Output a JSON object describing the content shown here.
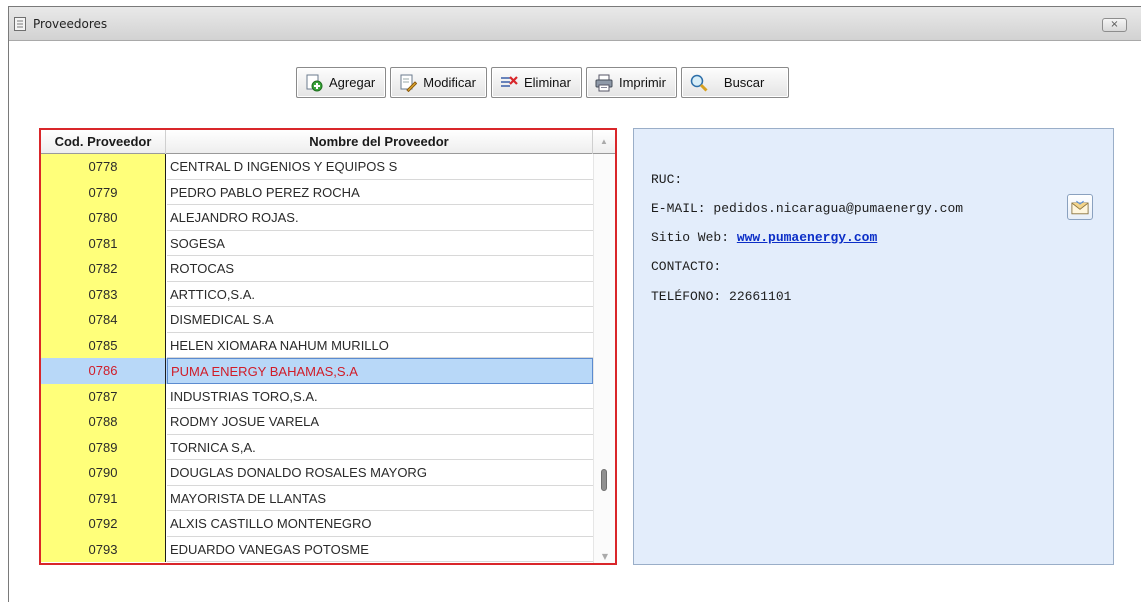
{
  "window": {
    "title": "Proveedores",
    "close_label": "×"
  },
  "toolbar": {
    "buttons": [
      {
        "label": "Agregar",
        "icon": "add-document-icon"
      },
      {
        "label": "Modificar",
        "icon": "edit-document-icon"
      },
      {
        "label": "Eliminar",
        "icon": "delete-rows-icon"
      },
      {
        "label": "Imprimir",
        "icon": "printer-icon"
      },
      {
        "label": "Buscar",
        "icon": "magnifier-icon"
      }
    ]
  },
  "grid": {
    "columns": [
      "Cod. Proveedor",
      "Nombre del Proveedor"
    ],
    "rows": [
      {
        "code": "0778",
        "name": "CENTRAL D INGENIOS Y EQUIPOS S"
      },
      {
        "code": "0779",
        "name": "PEDRO PABLO PEREZ ROCHA"
      },
      {
        "code": "0780",
        "name": "ALEJANDRO ROJAS."
      },
      {
        "code": "0781",
        "name": "SOGESA"
      },
      {
        "code": "0782",
        "name": "ROTOCAS"
      },
      {
        "code": "0783",
        "name": "ARTTICO,S.A."
      },
      {
        "code": "0784",
        "name": "DISMEDICAL S.A"
      },
      {
        "code": "0785",
        "name": "HELEN XIOMARA NAHUM MURILLO"
      },
      {
        "code": "0786",
        "name": "PUMA ENERGY BAHAMAS,S.A"
      },
      {
        "code": "0787",
        "name": "INDUSTRIAS TORO,S.A."
      },
      {
        "code": "0788",
        "name": "RODMY JOSUE VARELA"
      },
      {
        "code": "0789",
        "name": "TORNICA S,A."
      },
      {
        "code": "0790",
        "name": "DOUGLAS DONALDO ROSALES MAYORG"
      },
      {
        "code": "0791",
        "name": "MAYORISTA DE LLANTAS"
      },
      {
        "code": "0792",
        "name": "ALXIS CASTILLO MONTENEGRO"
      },
      {
        "code": "0793",
        "name": "EDUARDO VANEGAS POTOSME"
      }
    ],
    "selected_code": "0786"
  },
  "detail": {
    "ruc_label": "RUC:",
    "email_label": "E-MAIL:",
    "email_value": "pedidos.nicaragua@pumaenergy.com",
    "web_label": "Sitio Web:",
    "web_value": "www.pumaenergy.com",
    "contact_label": "CONTACTO:",
    "phone_label": "TELÉFONO:",
    "phone_value": "22661101"
  },
  "colors": {
    "code_column_bg": "#ffff7a",
    "selected_row_bg": "#b8d8f8",
    "selected_text": "#d01c28",
    "grid_border": "#d9262a",
    "detail_bg": "#e3edfb",
    "link": "#0b2ec7"
  }
}
